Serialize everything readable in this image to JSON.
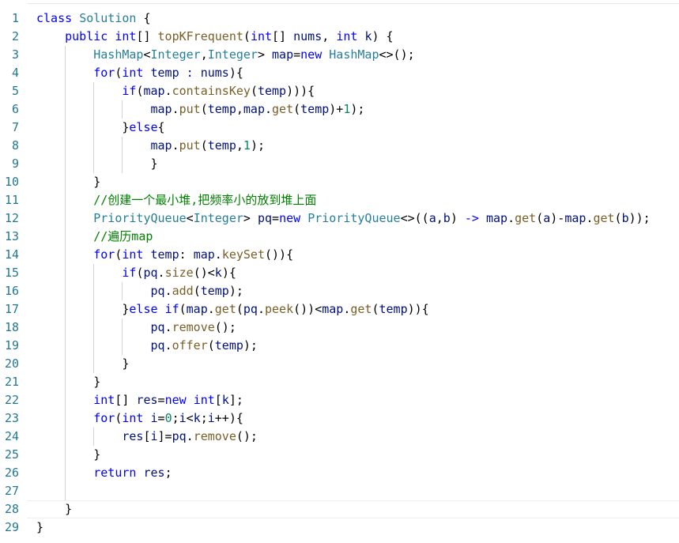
{
  "editor": {
    "language": "java",
    "colors": {
      "background": "#ffffff",
      "line_number": "#237893",
      "keyword": "#0000ff",
      "type": "#267f99",
      "function": "#795e26",
      "variable": "#001080",
      "number": "#098658",
      "comment": "#008000",
      "plain": "#000000"
    },
    "current_line": 28,
    "lines": [
      {
        "n": "1",
        "indent": 0,
        "tokens": [
          [
            "kw",
            "class"
          ],
          [
            "pl",
            " "
          ],
          [
            "ty",
            "Solution"
          ],
          [
            "pl",
            " {"
          ]
        ]
      },
      {
        "n": "2",
        "indent": 1,
        "tokens": [
          [
            "kw",
            "public"
          ],
          [
            "pl",
            " "
          ],
          [
            "kw",
            "int"
          ],
          [
            "pl",
            "[] "
          ],
          [
            "fn",
            "topKFrequent"
          ],
          [
            "pl",
            "("
          ],
          [
            "kw",
            "int"
          ],
          [
            "pl",
            "[] "
          ],
          [
            "var",
            "nums"
          ],
          [
            "pl",
            ", "
          ],
          [
            "kw",
            "int"
          ],
          [
            "pl",
            " "
          ],
          [
            "var",
            "k"
          ],
          [
            "pl",
            ") {"
          ]
        ]
      },
      {
        "n": "3",
        "indent": 2,
        "tokens": [
          [
            "ty",
            "HashMap"
          ],
          [
            "pl",
            "<"
          ],
          [
            "ty",
            "Integer"
          ],
          [
            "pl",
            ","
          ],
          [
            "ty",
            "Integer"
          ],
          [
            "pl",
            "> "
          ],
          [
            "var",
            "map"
          ],
          [
            "pl",
            "="
          ],
          [
            "kw",
            "new"
          ],
          [
            "pl",
            " "
          ],
          [
            "ty",
            "HashMap"
          ],
          [
            "pl",
            "<>();"
          ]
        ]
      },
      {
        "n": "4",
        "indent": 2,
        "tokens": [
          [
            "kw",
            "for"
          ],
          [
            "pl",
            "("
          ],
          [
            "kw",
            "int"
          ],
          [
            "pl",
            " "
          ],
          [
            "var",
            "temp"
          ],
          [
            "pl",
            " "
          ],
          [
            "kw",
            ":"
          ],
          [
            "pl",
            " "
          ],
          [
            "var",
            "nums"
          ],
          [
            "pl",
            "){"
          ]
        ]
      },
      {
        "n": "5",
        "indent": 3,
        "tokens": [
          [
            "kw",
            "if"
          ],
          [
            "pl",
            "("
          ],
          [
            "var",
            "map"
          ],
          [
            "pl",
            "."
          ],
          [
            "fn",
            "containsKey"
          ],
          [
            "pl",
            "("
          ],
          [
            "var",
            "temp"
          ],
          [
            "pl",
            "))){"
          ]
        ]
      },
      {
        "n": "6",
        "indent": 4,
        "tokens": [
          [
            "var",
            "map"
          ],
          [
            "pl",
            "."
          ],
          [
            "fn",
            "put"
          ],
          [
            "pl",
            "("
          ],
          [
            "var",
            "temp"
          ],
          [
            "pl",
            ","
          ],
          [
            "var",
            "map"
          ],
          [
            "pl",
            "."
          ],
          [
            "fn",
            "get"
          ],
          [
            "pl",
            "("
          ],
          [
            "var",
            "temp"
          ],
          [
            "pl",
            ")+"
          ],
          [
            "num",
            "1"
          ],
          [
            "pl",
            ");"
          ]
        ]
      },
      {
        "n": "7",
        "indent": 3,
        "tokens": [
          [
            "pl",
            "}"
          ],
          [
            "kw",
            "else"
          ],
          [
            "pl",
            "{"
          ]
        ]
      },
      {
        "n": "8",
        "indent": 4,
        "tokens": [
          [
            "var",
            "map"
          ],
          [
            "pl",
            "."
          ],
          [
            "fn",
            "put"
          ],
          [
            "pl",
            "("
          ],
          [
            "var",
            "temp"
          ],
          [
            "pl",
            ","
          ],
          [
            "num",
            "1"
          ],
          [
            "pl",
            ");"
          ]
        ]
      },
      {
        "n": "9",
        "indent": 4,
        "tokens": [
          [
            "pl",
            "}"
          ]
        ]
      },
      {
        "n": "10",
        "indent": 2,
        "tokens": [
          [
            "pl",
            "}"
          ]
        ]
      },
      {
        "n": "11",
        "indent": 2,
        "tokens": [
          [
            "cm",
            "//创建一个最小堆,把频率小的放到堆上面"
          ]
        ]
      },
      {
        "n": "12",
        "indent": 2,
        "tokens": [
          [
            "ty",
            "PriorityQueue"
          ],
          [
            "pl",
            "<"
          ],
          [
            "ty",
            "Integer"
          ],
          [
            "pl",
            "> "
          ],
          [
            "var",
            "pq"
          ],
          [
            "pl",
            "="
          ],
          [
            "kw",
            "new"
          ],
          [
            "pl",
            " "
          ],
          [
            "ty",
            "PriorityQueue"
          ],
          [
            "pl",
            "<>(("
          ],
          [
            "var",
            "a"
          ],
          [
            "pl",
            ","
          ],
          [
            "var",
            "b"
          ],
          [
            "pl",
            ") "
          ],
          [
            "kw",
            "->"
          ],
          [
            "pl",
            " "
          ],
          [
            "var",
            "map"
          ],
          [
            "pl",
            "."
          ],
          [
            "fn",
            "get"
          ],
          [
            "pl",
            "("
          ],
          [
            "var",
            "a"
          ],
          [
            "pl",
            ")-"
          ],
          [
            "var",
            "map"
          ],
          [
            "pl",
            "."
          ],
          [
            "fn",
            "get"
          ],
          [
            "pl",
            "("
          ],
          [
            "var",
            "b"
          ],
          [
            "pl",
            "));"
          ]
        ]
      },
      {
        "n": "13",
        "indent": 2,
        "tokens": [
          [
            "cm",
            "//遍历map"
          ]
        ]
      },
      {
        "n": "14",
        "indent": 2,
        "tokens": [
          [
            "kw",
            "for"
          ],
          [
            "pl",
            "("
          ],
          [
            "kw",
            "int"
          ],
          [
            "pl",
            " "
          ],
          [
            "var",
            "temp"
          ],
          [
            "pl",
            ": "
          ],
          [
            "var",
            "map"
          ],
          [
            "pl",
            "."
          ],
          [
            "fn",
            "keySet"
          ],
          [
            "pl",
            "()){"
          ]
        ]
      },
      {
        "n": "15",
        "indent": 3,
        "tokens": [
          [
            "kw",
            "if"
          ],
          [
            "pl",
            "("
          ],
          [
            "var",
            "pq"
          ],
          [
            "pl",
            "."
          ],
          [
            "fn",
            "size"
          ],
          [
            "pl",
            "()<"
          ],
          [
            "var",
            "k"
          ],
          [
            "pl",
            "){"
          ]
        ]
      },
      {
        "n": "16",
        "indent": 4,
        "tokens": [
          [
            "var",
            "pq"
          ],
          [
            "pl",
            "."
          ],
          [
            "fn",
            "add"
          ],
          [
            "pl",
            "("
          ],
          [
            "var",
            "temp"
          ],
          [
            "pl",
            ");"
          ]
        ]
      },
      {
        "n": "17",
        "indent": 3,
        "tokens": [
          [
            "pl",
            "}"
          ],
          [
            "kw",
            "else"
          ],
          [
            "pl",
            " "
          ],
          [
            "kw",
            "if"
          ],
          [
            "pl",
            "("
          ],
          [
            "var",
            "map"
          ],
          [
            "pl",
            "."
          ],
          [
            "fn",
            "get"
          ],
          [
            "pl",
            "("
          ],
          [
            "var",
            "pq"
          ],
          [
            "pl",
            "."
          ],
          [
            "fn",
            "peek"
          ],
          [
            "pl",
            "())<"
          ],
          [
            "var",
            "map"
          ],
          [
            "pl",
            "."
          ],
          [
            "fn",
            "get"
          ],
          [
            "pl",
            "("
          ],
          [
            "var",
            "temp"
          ],
          [
            "pl",
            ")){"
          ]
        ]
      },
      {
        "n": "18",
        "indent": 4,
        "tokens": [
          [
            "var",
            "pq"
          ],
          [
            "pl",
            "."
          ],
          [
            "fn",
            "remove"
          ],
          [
            "pl",
            "();"
          ]
        ]
      },
      {
        "n": "19",
        "indent": 4,
        "tokens": [
          [
            "var",
            "pq"
          ],
          [
            "pl",
            "."
          ],
          [
            "fn",
            "offer"
          ],
          [
            "pl",
            "("
          ],
          [
            "var",
            "temp"
          ],
          [
            "pl",
            ");"
          ]
        ]
      },
      {
        "n": "20",
        "indent": 3,
        "tokens": [
          [
            "pl",
            "}"
          ]
        ]
      },
      {
        "n": "21",
        "indent": 2,
        "tokens": [
          [
            "pl",
            "}"
          ]
        ]
      },
      {
        "n": "22",
        "indent": 2,
        "tokens": [
          [
            "kw",
            "int"
          ],
          [
            "pl",
            "[] "
          ],
          [
            "var",
            "res"
          ],
          [
            "pl",
            "="
          ],
          [
            "kw",
            "new"
          ],
          [
            "pl",
            " "
          ],
          [
            "kw",
            "int"
          ],
          [
            "pl",
            "["
          ],
          [
            "var",
            "k"
          ],
          [
            "pl",
            "];"
          ]
        ]
      },
      {
        "n": "23",
        "indent": 2,
        "tokens": [
          [
            "kw",
            "for"
          ],
          [
            "pl",
            "("
          ],
          [
            "kw",
            "int"
          ],
          [
            "pl",
            " "
          ],
          [
            "var",
            "i"
          ],
          [
            "pl",
            "="
          ],
          [
            "num",
            "0"
          ],
          [
            "pl",
            ";"
          ],
          [
            "var",
            "i"
          ],
          [
            "pl",
            "<"
          ],
          [
            "var",
            "k"
          ],
          [
            "pl",
            ";"
          ],
          [
            "var",
            "i"
          ],
          [
            "pl",
            "++){"
          ]
        ]
      },
      {
        "n": "24",
        "indent": 3,
        "tokens": [
          [
            "var",
            "res"
          ],
          [
            "pl",
            "["
          ],
          [
            "var",
            "i"
          ],
          [
            "pl",
            "]="
          ],
          [
            "var",
            "pq"
          ],
          [
            "pl",
            "."
          ],
          [
            "fn",
            "remove"
          ],
          [
            "pl",
            "();"
          ]
        ]
      },
      {
        "n": "25",
        "indent": 2,
        "tokens": [
          [
            "pl",
            "}"
          ]
        ]
      },
      {
        "n": "26",
        "indent": 2,
        "tokens": [
          [
            "kw",
            "return"
          ],
          [
            "pl",
            " "
          ],
          [
            "var",
            "res"
          ],
          [
            "pl",
            ";"
          ]
        ]
      },
      {
        "n": "27",
        "indent": 0,
        "tokens": []
      },
      {
        "n": "28",
        "indent": 1,
        "tokens": [
          [
            "pl",
            "}"
          ]
        ]
      },
      {
        "n": "29",
        "indent": 0,
        "tokens": [
          [
            "pl",
            "}"
          ]
        ]
      }
    ]
  }
}
